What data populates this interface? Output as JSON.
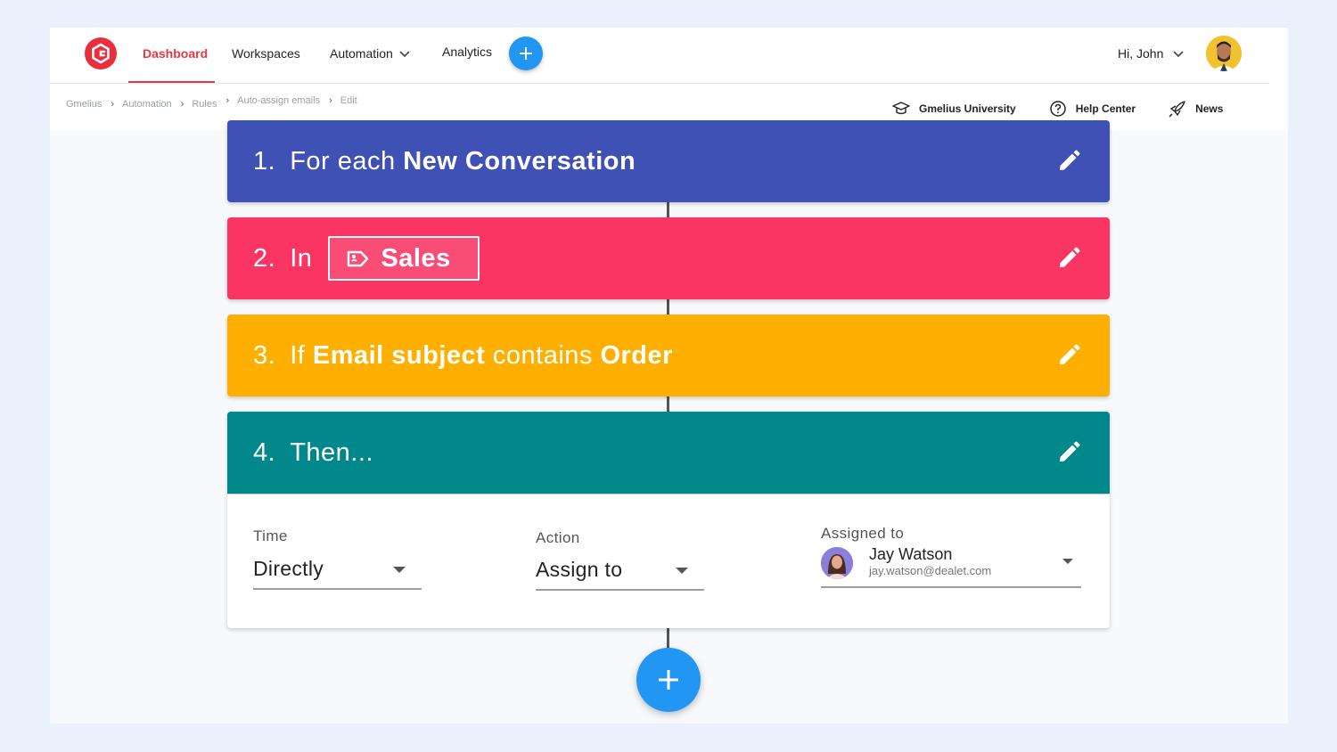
{
  "nav": {
    "items": [
      {
        "label": "Dashboard"
      },
      {
        "label": "Workspaces"
      },
      {
        "label": "Automation"
      },
      {
        "label": "Analytics"
      }
    ],
    "user_greeting": "Hi, John"
  },
  "breadcrumb": [
    "Gmelius",
    "Automation",
    "Rules",
    "Auto-assign emails",
    "Edit"
  ],
  "help_links": [
    {
      "label": "Gmelius University",
      "icon": "graduation-cap-icon"
    },
    {
      "label": "Help Center",
      "icon": "question-circle-icon"
    },
    {
      "label": "News",
      "icon": "rocket-icon"
    }
  ],
  "steps": [
    {
      "number": "1.",
      "text": "For each ",
      "bold": "New Conversation",
      "color": "#3f51b5"
    },
    {
      "number": "2.",
      "text": "In",
      "tag": "Sales",
      "color": "#fa3563"
    },
    {
      "number": "3.",
      "text_a": "If ",
      "bold_a": "Email subject",
      "text_b": " contains ",
      "bold_b": "Order",
      "color": "#ffaf00"
    },
    {
      "number": "4.",
      "text": "Then...",
      "color": "#00888a"
    }
  ],
  "action_panel": {
    "time": {
      "label": "Time",
      "value": "Directly"
    },
    "action": {
      "label": "Action",
      "value": "Assign to"
    },
    "assigned": {
      "label": "Assigned to",
      "name": "Jay Watson",
      "email": "jay.watson@dealet.com"
    }
  },
  "colors": {
    "accent": "#2196f3",
    "brand": "#ea2e3e",
    "active_nav": "#e53945"
  }
}
